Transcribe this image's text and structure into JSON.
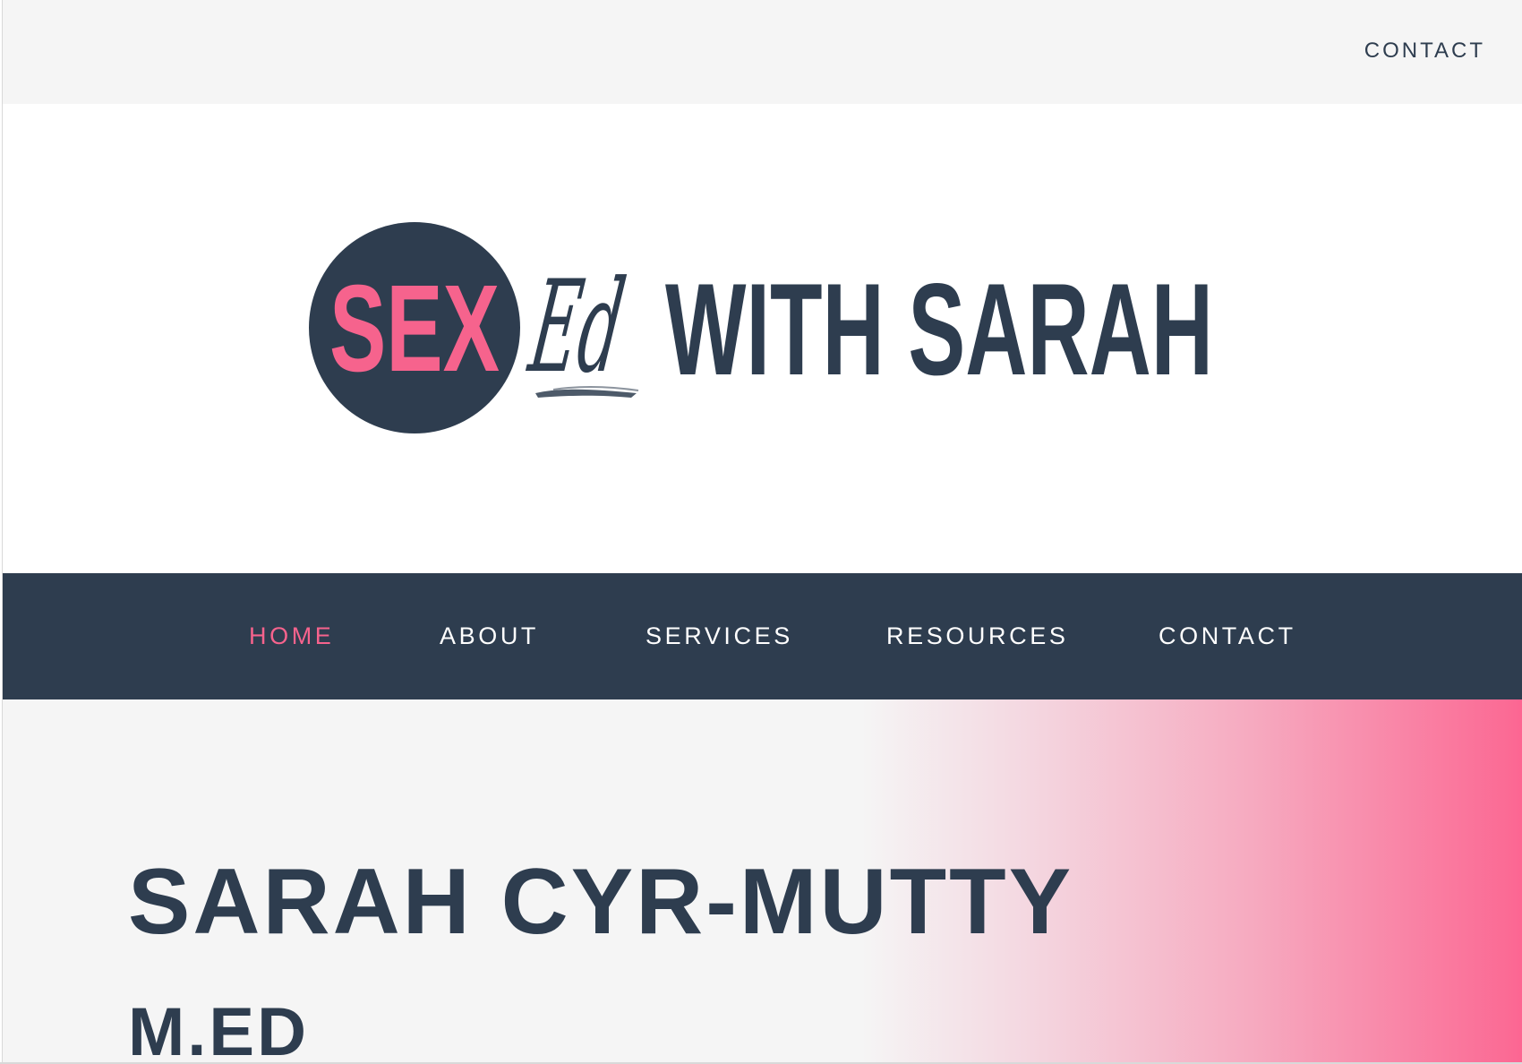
{
  "topbar": {
    "contact_label": "CONTACT"
  },
  "logo": {
    "circle_text": "SEX",
    "script_text": "Ed",
    "tagline": "WITH SARAH"
  },
  "nav": {
    "items": [
      {
        "label": "HOME",
        "active": true
      },
      {
        "label": "ABOUT",
        "active": false
      },
      {
        "label": "SERVICES",
        "active": false
      },
      {
        "label": "RESOURCES",
        "active": false
      },
      {
        "label": "CONTACT",
        "active": false
      }
    ]
  },
  "hero": {
    "name": "SARAH CYR-MUTTY",
    "credential": "M.ED"
  },
  "colors": {
    "navy": "#2e3d4f",
    "pink": "#f6638d",
    "light_gray": "#f5f5f5",
    "white": "#ffffff"
  }
}
